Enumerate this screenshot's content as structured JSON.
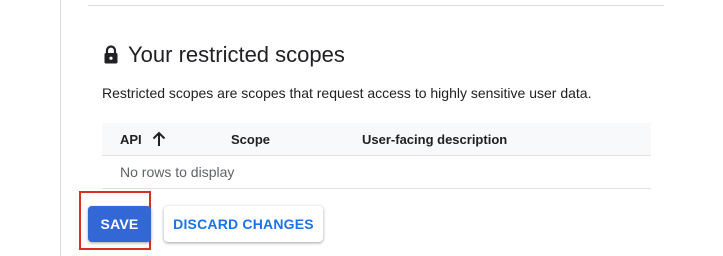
{
  "section": {
    "title": "Your restricted scopes",
    "description": "Restricted scopes are scopes that request access to highly sensitive user data.",
    "icon": "lock-icon"
  },
  "table": {
    "columns": [
      "API",
      "Scope",
      "User-facing description"
    ],
    "sort_column": "API",
    "sort_direction": "ascending",
    "empty_message": "No rows to display"
  },
  "actions": {
    "save_label": "SAVE",
    "discard_label": "DISCARD CHANGES"
  },
  "colors": {
    "primary": "#3367d6",
    "link": "#1a73e8",
    "highlight": "#d93025"
  }
}
